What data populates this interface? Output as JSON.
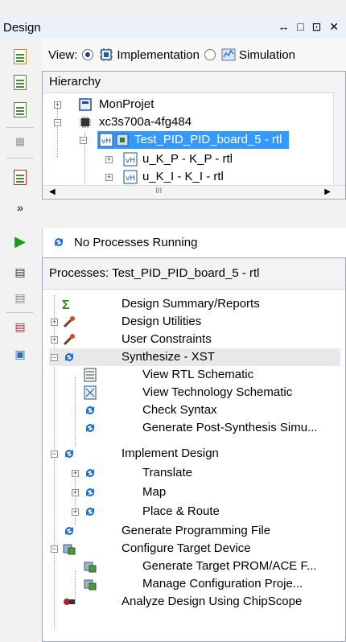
{
  "window": {
    "title": "Design",
    "controls": "↔ □ ⊡ ✕"
  },
  "view": {
    "label": "View:",
    "options": [
      {
        "label": "Implementation",
        "selected": true
      },
      {
        "label": "Simulation",
        "selected": false
      }
    ]
  },
  "hierarchy": {
    "header": "Hierarchy",
    "items": [
      {
        "label": "MonProjet",
        "icon": "project-icon"
      },
      {
        "label": "xc3s700a-4fg484",
        "icon": "chip-icon"
      },
      {
        "label": "Test_PID_PID_board_5 - rtl",
        "icon": "vhdl-module-icon",
        "selected": true
      },
      {
        "label": "u_K_P - K_P - rtl",
        "icon": "vhdl-module-icon"
      },
      {
        "label": "u_K_I - K_I - rtl",
        "icon": "vhdl-module-icon"
      }
    ],
    "scroll_marker": "III"
  },
  "status": {
    "text": "No Processes Running"
  },
  "processes": {
    "header": "Processes: Test_PID_PID_board_5 - rtl",
    "items": [
      {
        "label": "Design Summary/Reports",
        "icon": "sigma-icon"
      },
      {
        "label": "Design Utilities",
        "icon": "tools-icon"
      },
      {
        "label": "User Constraints",
        "icon": "tools-icon"
      },
      {
        "label": "Synthesize - XST",
        "icon": "refresh-icon"
      },
      {
        "label": "View RTL Schematic",
        "icon": "schematic-icon"
      },
      {
        "label": "View Technology Schematic",
        "icon": "schematic-icon"
      },
      {
        "label": "Check Syntax",
        "icon": "refresh-icon"
      },
      {
        "label": "Generate Post-Synthesis Simu...",
        "icon": "refresh-icon"
      },
      {
        "label": "Implement Design",
        "icon": "refresh-icon"
      },
      {
        "label": "Translate",
        "icon": "refresh-icon"
      },
      {
        "label": "Map",
        "icon": "refresh-icon"
      },
      {
        "label": "Place & Route",
        "icon": "refresh-icon"
      },
      {
        "label": "Generate Programming File",
        "icon": "refresh-icon"
      },
      {
        "label": "Configure Target Device",
        "icon": "device-icon"
      },
      {
        "label": "Generate Target PROM/ACE F...",
        "icon": "device-icon"
      },
      {
        "label": "Manage Configuration Proje...",
        "icon": "device-icon"
      },
      {
        "label": "Analyze Design Using ChipScope",
        "icon": "chipscope-icon"
      }
    ]
  },
  "colors": {
    "selection": "#3399ff",
    "run": "#1a9a1a",
    "refresh": "#1b6fd1"
  }
}
